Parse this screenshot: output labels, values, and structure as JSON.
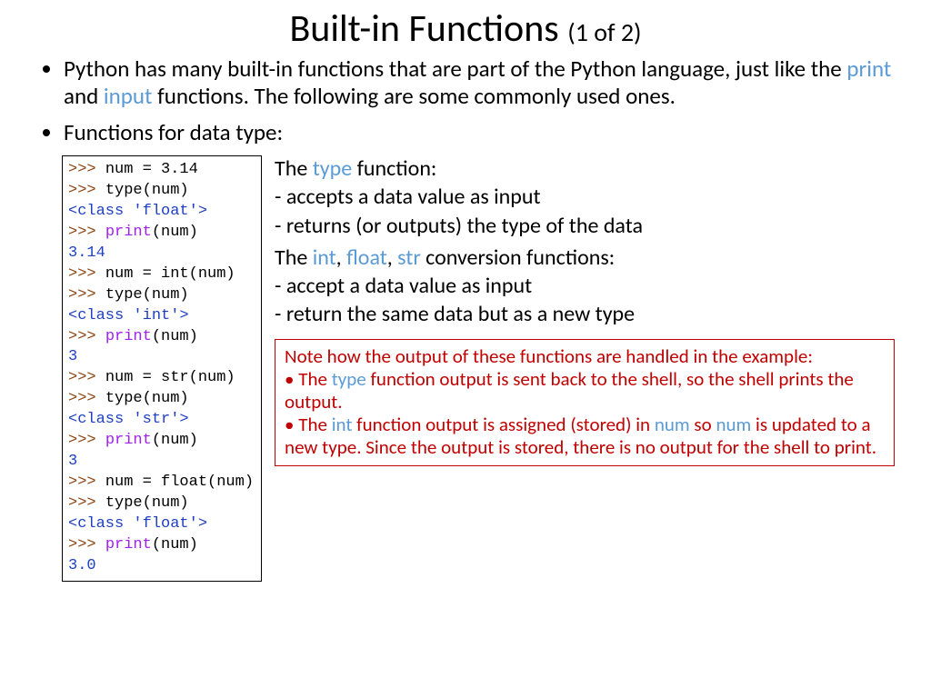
{
  "title": {
    "main": "Built-in Functions",
    "sub": "(1 of 2)"
  },
  "bullets": {
    "b1_a": "Python has many built-in functions that are part of the Python language, just like the ",
    "b1_print": "print",
    "b1_and": " and ",
    "b1_input": "input",
    "b1_b": " functions. The following are some commonly used ones.",
    "b2": "Functions for data type:"
  },
  "code": {
    "l01a": ">>> ",
    "l01b": "num = 3.14",
    "l02a": ">>> ",
    "l02b": "type(num)",
    "l03": "<class 'float'>",
    "l04a": ">>> ",
    "l04b": "print",
    "l04c": "(num)",
    "l05": "3.14",
    "l06a": ">>> ",
    "l06b": "num = int(num)",
    "l07a": ">>> ",
    "l07b": "type(num)",
    "l08": "<class 'int'>",
    "l09a": ">>> ",
    "l09b": "print",
    "l09c": "(num)",
    "l10": "3",
    "l11a": ">>> ",
    "l11b": "num = str(num)",
    "l12a": ">>> ",
    "l12b": "type(num)",
    "l13": "<class 'str'>",
    "l14a": ">>> ",
    "l14b": "print",
    "l14c": "(num)",
    "l15": "3",
    "l16a": ">>> ",
    "l16b": "num = float(num)",
    "l17a": ">>> ",
    "l17b": "type(num)",
    "l18": "<class 'float'>",
    "l19a": ">>> ",
    "l19b": "print",
    "l19c": "(num)",
    "l20": "3.0"
  },
  "right": {
    "type_head_a": "The ",
    "type_head_fn": "type",
    "type_head_b": " function:",
    "type_l1": "- accepts a data value as input",
    "type_l2": "- returns (or outputs) the type of the data",
    "conv_head_a": "The ",
    "conv_int": "int",
    "conv_c1": ", ",
    "conv_float": "float",
    "conv_c2": ", ",
    "conv_str": "str",
    "conv_head_b": " conversion functions:",
    "conv_l1": "- accept a data value as input",
    "conv_l2": "- return the same data but as a new type"
  },
  "note": {
    "n0": "Note how the output of these functions are handled in the example:",
    "n1a": "The ",
    "n1_type": "type",
    "n1b": " function output is sent back to the shell, so the shell prints the output.",
    "n2a": "The ",
    "n2_int": "int",
    "n2b": " function output is assigned (stored) in ",
    "n2_num": "num",
    "n2c": " so ",
    "n2_num2": "num",
    "n2d": " is updated to a new type. Since the output is stored, there is no output for the shell to print."
  }
}
